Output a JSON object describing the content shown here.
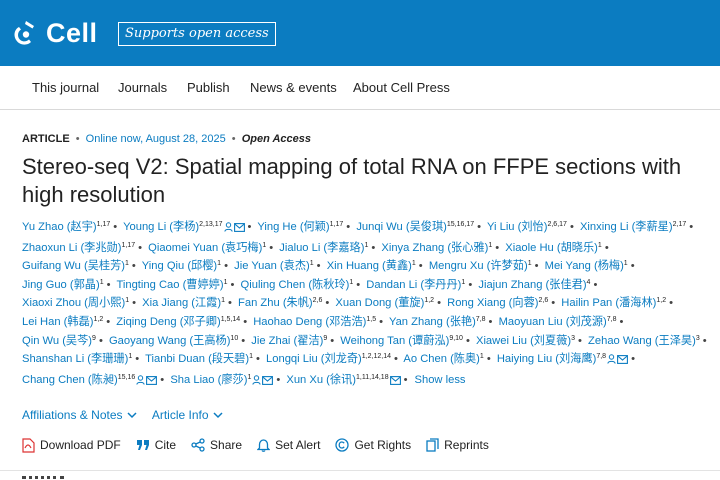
{
  "header": {
    "logo_text": "Cell",
    "tagline": "Supports open access",
    "brand_color": "#0b7cc1"
  },
  "nav": {
    "items": [
      {
        "label": "This journal"
      },
      {
        "label": "Journals"
      },
      {
        "label": "Publish"
      },
      {
        "label": "News & events"
      },
      {
        "label": "About Cell Press"
      }
    ]
  },
  "article": {
    "type": "ARTICLE",
    "status": "Online now, August 28, 2025",
    "access": "Open Access",
    "title": "Stereo-seq V2: Spatial mapping of total RNA on FFPE sections with high resolution"
  },
  "authors": [
    {
      "name": "Yu Zhao (赵宇)",
      "sup": "1,17"
    },
    {
      "name": "Young Li (李杨)",
      "sup": "2,13,17",
      "person": true,
      "mail": true
    },
    {
      "name": "Ying He (何颖)",
      "sup": "1,17"
    },
    {
      "name": "Junqi Wu (吴俊琪)",
      "sup": "15,16,17"
    },
    {
      "name": "Yi Liu (刘怡)",
      "sup": "2,6,17"
    },
    {
      "name": "Xinxing Li (李薪星)",
      "sup": "2,17"
    },
    {
      "name": "Zhaoxun Li (李兆勋)",
      "sup": "1,17"
    },
    {
      "name": "Qiaomei Yuan (袁巧梅)",
      "sup": "1"
    },
    {
      "name": "Jialuo Li (李嘉珞)",
      "sup": "1"
    },
    {
      "name": "Xinya Zhang (张心雅)",
      "sup": "1"
    },
    {
      "name": "Xiaole Hu (胡晓乐)",
      "sup": "1"
    },
    {
      "name": "Guifang Wu (吴桂芳)",
      "sup": "1"
    },
    {
      "name": "Ying Qiu (邱樱)",
      "sup": "1"
    },
    {
      "name": "Jie Yuan (袁杰)",
      "sup": "1"
    },
    {
      "name": "Xin Huang (黄鑫)",
      "sup": "1"
    },
    {
      "name": "Mengru Xu (许梦茹)",
      "sup": "1"
    },
    {
      "name": "Mei Yang (杨梅)",
      "sup": "1"
    },
    {
      "name": "Jing Guo (郭晶)",
      "sup": "1"
    },
    {
      "name": "Tingting Cao (曹婷婷)",
      "sup": "1"
    },
    {
      "name": "Qiuling Chen (陈秋玲)",
      "sup": "1"
    },
    {
      "name": "Dandan Li (李丹丹)",
      "sup": "1"
    },
    {
      "name": "Jiajun Zhang (张佳君)",
      "sup": "4"
    },
    {
      "name": "Xiaoxi Zhou (周小熙)",
      "sup": "1"
    },
    {
      "name": "Xia Jiang (江霞)",
      "sup": "1"
    },
    {
      "name": "Fan Zhu (朱帆)",
      "sup": "2,6"
    },
    {
      "name": "Xuan Dong (董旋)",
      "sup": "1,2"
    },
    {
      "name": "Rong Xiang (向蓉)",
      "sup": "2,6"
    },
    {
      "name": "Hailin Pan (潘海林)",
      "sup": "1,2"
    },
    {
      "name": "Lei Han (韩磊)",
      "sup": "1,2"
    },
    {
      "name": "Ziqing Deng (邓子卿)",
      "sup": "1,5,14"
    },
    {
      "name": "Haohao Deng (邓浩浩)",
      "sup": "1,5"
    },
    {
      "name": "Yan Zhang (张艳)",
      "sup": "7,8"
    },
    {
      "name": "Maoyuan Liu (刘茂源)",
      "sup": "7,8"
    },
    {
      "name": "Qin Wu (吴芩)",
      "sup": "9"
    },
    {
      "name": "Gaoyang Wang (王高杨)",
      "sup": "10"
    },
    {
      "name": "Jie Zhai (翟洁)",
      "sup": "9"
    },
    {
      "name": "Weihong Tan (谭蔚泓)",
      "sup": "9,10"
    },
    {
      "name": "Xiawei Liu (刘夏薇)",
      "sup": "3"
    },
    {
      "name": "Zehao Wang (王泽昊)",
      "sup": "3"
    },
    {
      "name": "Shanshan Li (李珊珊)",
      "sup": "1"
    },
    {
      "name": "Tianbi Duan (段天碧)",
      "sup": "1"
    },
    {
      "name": "Longqi Liu (刘龙奇)",
      "sup": "1,2,12,14"
    },
    {
      "name": "Ao Chen (陈奥)",
      "sup": "1"
    },
    {
      "name": "Haiying Liu (刘海鹰)",
      "sup": "7,8",
      "person": true,
      "mail": true
    },
    {
      "name": "Chang Chen (陈昶)",
      "sup": "15,16",
      "person": true,
      "mail": true
    },
    {
      "name": "Sha Liao (廖莎)",
      "sup": "1",
      "person": true,
      "mail": true
    },
    {
      "name": "Xun Xu (徐讯)",
      "sup": "1,11,14,18",
      "mail": true
    }
  ],
  "show_less": "Show less",
  "affiliations": {
    "aff_label": "Affiliations & Notes",
    "info_label": "Article Info"
  },
  "tools": {
    "download_pdf": "Download PDF",
    "cite": "Cite",
    "share": "Share",
    "set_alert": "Set Alert",
    "get_rights": "Get Rights",
    "reprints": "Reprints"
  }
}
